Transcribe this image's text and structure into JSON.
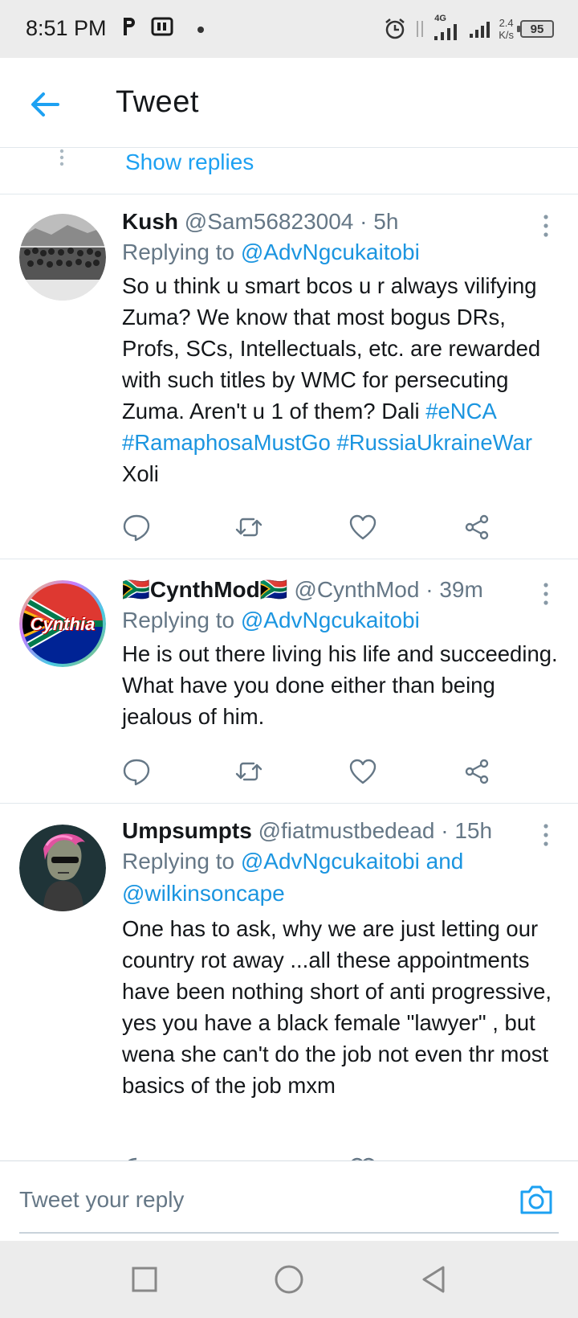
{
  "status_bar": {
    "time": "8:51 PM",
    "network": "4G",
    "speed_value": "2.4",
    "speed_unit": "K/s",
    "battery": "95"
  },
  "header": {
    "title": "Tweet",
    "back_icon": "arrow-left-icon"
  },
  "thread": {
    "show_replies_label": "Show replies"
  },
  "tweets": [
    {
      "name": "Kush",
      "handle": "@Sam56823004",
      "time": "· 5h",
      "replying_prefix": "Replying to",
      "replying_to": "@AdvNgcukaitobi",
      "replying_to_2": "",
      "text_parts": {
        "a": "So u think u smart bcos u r always vilifying Zuma? We know that most bogus DRs, Profs, SCs, Intellectuals, etc. are rewarded with such titles by WMC for persecuting Zuma. Aren't u 1 of them? Dali ",
        "tag1": "#eNCA",
        "tag2": "#RamaphosaMustGo",
        "tag3": "#RussiaUkraineWar",
        "b": " Xoli"
      }
    },
    {
      "name_flag_left": "🇿🇦",
      "name": "CynthMod",
      "name_flag_right": "🇿🇦",
      "avatar_label": "Cynthia",
      "handle": "@CynthMod",
      "time": "· 39m",
      "replying_prefix": "Replying to",
      "replying_to": "@AdvNgcukaitobi",
      "text": "He is out there living his life and succeeding. What have you done either than being jealous of him."
    },
    {
      "name": "Umpsumpts",
      "handle": "@fiatmustbedead",
      "time": "· 15h",
      "replying_prefix": "Replying to",
      "replying_to": "@AdvNgcukaitobi",
      "replying_and": "and",
      "replying_to_2": "@wilkinsoncape",
      "text": "One has to ask,  why we are just letting our country rot away ...all these appointments have been nothing short of anti progressive, yes you have a black female \"lawyer\" , but wena she can't do the job not even thr most basics of the job mxm"
    }
  ],
  "reply_bar": {
    "placeholder": "Tweet your reply",
    "camera_icon": "camera-icon"
  },
  "nav_bar": {
    "recents_icon": "square-icon",
    "home_icon": "circle-icon",
    "back_icon": "triangle-back-icon"
  },
  "colors": {
    "accent": "#1da1f2",
    "link": "#1b95e0",
    "text": "#14171a",
    "secondary": "#657786",
    "divider": "#e1e8ed"
  }
}
